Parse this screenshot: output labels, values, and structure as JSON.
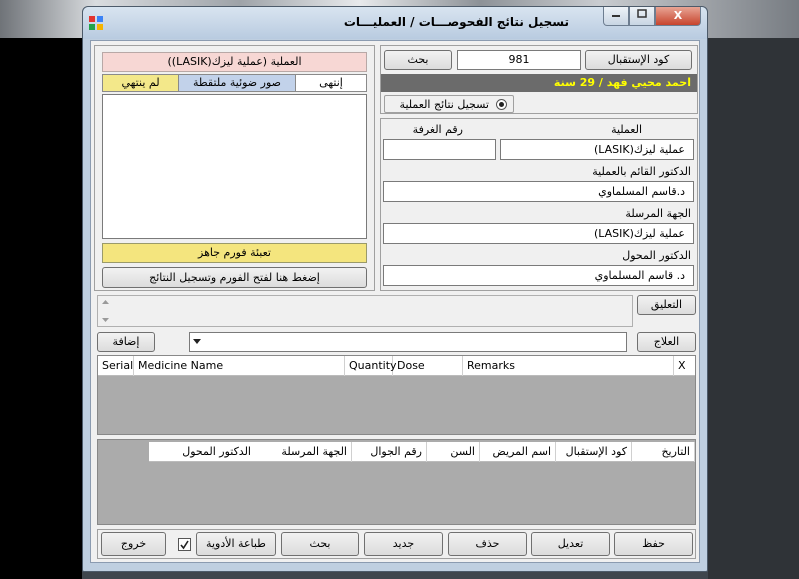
{
  "window": {
    "title": "تسجيل نتائج الفحوصـــات / العمليـــات",
    "close_label": "X"
  },
  "search": {
    "reception_code_label": "كود الإستقبال",
    "reception_code_value": "981",
    "search_button": "بحث"
  },
  "patient": {
    "banner": "احمد محيي فهد / 29 سنة",
    "register_result_label": "تسجيل نتائج العملية"
  },
  "operation_details": {
    "operation_label": "العملية",
    "operation_value": "عملية ليزك(LASIK)",
    "room_label": "رقم الغرفة",
    "room_value": "",
    "surgeon_label": "الدكتور القائم بالعملية",
    "surgeon_value": "د.قاسم المسلماوي",
    "sender_label": "الجهة المرسلة",
    "sender_value": "عملية ليزك(LASIK)",
    "referring_doctor_label": "الدكتور المحول",
    "referring_doctor_value": "د. قاسم المسلماوي"
  },
  "left_panel": {
    "operation_header": "العملية (عملية ليزك(LASIK))",
    "status_not_finished": "لم ينتهي",
    "status_captured_images": "صور ضوئية ملتقطة",
    "status_finished": "إنتهى",
    "ready_form_label": "تعبئة فورم جاهز",
    "open_form_button": "إضغط هنا لفتح الفورم وتسجيل النتائج"
  },
  "comment": {
    "label": "التعليق",
    "value": ""
  },
  "treatment": {
    "label": "العلاج",
    "add_button": "إضافة",
    "value": ""
  },
  "medicine_table": {
    "columns": [
      "Serial",
      "Medicine Name",
      "Quantity",
      "Dose",
      "Remarks",
      "X"
    ]
  },
  "records_table": {
    "columns": [
      "التاريخ",
      "كود الإستقبال",
      "اسم المريض",
      "السن",
      "رقم الجوال",
      "الجهة المرسلة",
      "الدكتور المحول"
    ]
  },
  "footer": {
    "save": "حفظ",
    "edit": "تعديل",
    "delete": "حذف",
    "new": "جديد",
    "search": "بحث",
    "print_medicines": "طباعة الأدوية",
    "print_medicines_checked": true,
    "exit": "خروج"
  },
  "colors": {
    "banner_bg": "#6b6b6b",
    "banner_text": "#ffff00",
    "header_pink": "#f7d7d4",
    "status_yellow": "#f3e88a",
    "status_blue": "#c2d2ea",
    "ready_yellow": "#f4e57e"
  }
}
